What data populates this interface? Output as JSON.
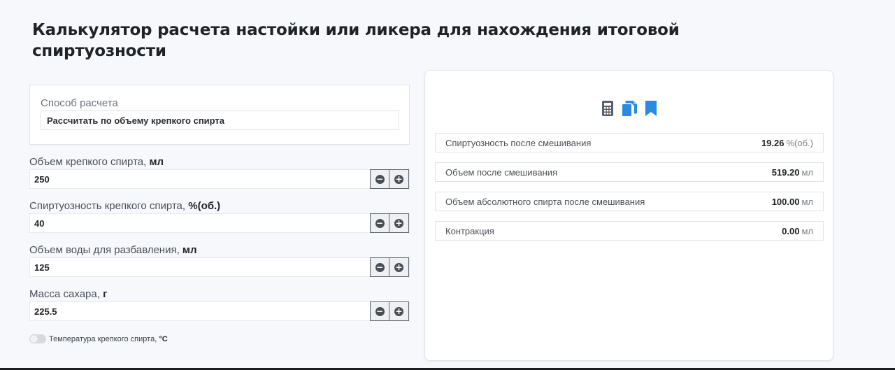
{
  "title": "Калькулятор расчета настойки или ликера для нахождения итоговой спиртуозности",
  "method": {
    "label": "Способ расчета",
    "selected": "Рассчитать по объему крепкого спирта"
  },
  "fields": [
    {
      "label": "Объем крепкого спирта, ",
      "unit": "мл",
      "value": "250"
    },
    {
      "label": "Спиртуозность крепкого спирта, ",
      "unit": "%(об.)",
      "value": "40"
    },
    {
      "label": "Объем воды для разбавления, ",
      "unit": "мл",
      "value": "125"
    },
    {
      "label": "Масса сахара, ",
      "unit": "г",
      "value": "225.5"
    }
  ],
  "stepper": {
    "minus": "−",
    "plus": "+"
  },
  "temperature_toggle": {
    "label": "Температура крепкого спирта, ",
    "unit": "°C",
    "enabled": false
  },
  "results": [
    {
      "label": "Спиртуозность после смешивания",
      "value": "19.26",
      "unit": "%(об.)"
    },
    {
      "label": "Объем после смешивания",
      "value": "519.20",
      "unit": "мл"
    },
    {
      "label": "Объем абсолютного спирта после смешивания",
      "value": "100.00",
      "unit": "мл"
    },
    {
      "label": "Контракция",
      "value": "0.00",
      "unit": "мл"
    }
  ],
  "toolbar_icons": [
    "calculator-icon",
    "copy-icon",
    "bookmark-icon"
  ],
  "colors": {
    "accent": "#2a8be0",
    "icon_dark": "#5a6068",
    "background": "#f6f8fb"
  }
}
